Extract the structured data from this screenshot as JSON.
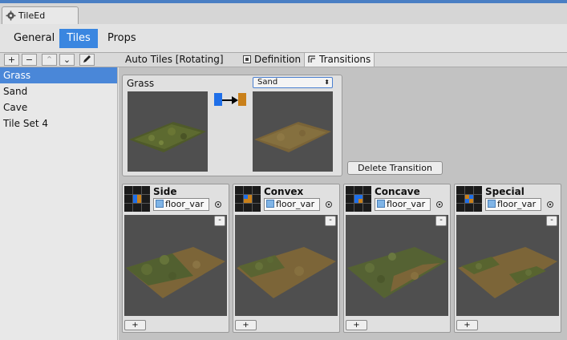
{
  "window": {
    "tab_title": "TileEd"
  },
  "nav": {
    "tabs": [
      {
        "label": "General",
        "active": false
      },
      {
        "label": "Tiles",
        "active": true
      },
      {
        "label": "Props",
        "active": false
      }
    ]
  },
  "toolbar": {
    "buttons": [
      "+",
      "−",
      "⌃",
      "⌄"
    ],
    "subtabs": [
      {
        "label": "Auto Tiles [Rotating]",
        "active": false
      },
      {
        "label": "Definition",
        "active": false
      },
      {
        "label": "Transitions",
        "active": true
      }
    ]
  },
  "sidebar": {
    "items": [
      {
        "label": "Grass",
        "selected": true
      },
      {
        "label": "Sand",
        "selected": false
      },
      {
        "label": "Cave",
        "selected": false
      },
      {
        "label": "Tile Set 4",
        "selected": false
      }
    ]
  },
  "transition": {
    "from_label": "Grass",
    "to_select": "Sand",
    "delete_label": "Delete Transition",
    "colors": {
      "from": "#1f6fe8",
      "to": "#c9801a"
    }
  },
  "panels": [
    {
      "title": "Side",
      "field": "floor_var",
      "minus": "-",
      "plus": "+"
    },
    {
      "title": "Convex",
      "field": "floor_var",
      "minus": "-",
      "plus": "+"
    },
    {
      "title": "Concave",
      "field": "floor_var",
      "minus": "-",
      "plus": "+"
    },
    {
      "title": "Special",
      "field": "floor_var",
      "minus": "-",
      "plus": "+"
    }
  ]
}
